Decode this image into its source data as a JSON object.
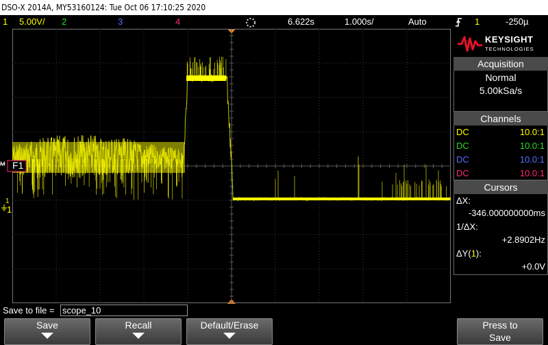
{
  "title_bar": {
    "text": "DSO-X 2014A, MY53160124: Tue Oct 06 17:10:25 2020"
  },
  "status": {
    "ch1_num": "1",
    "ch1_scale": "5.00V/",
    "ch2_num": "2",
    "ch3_num": "3",
    "ch4_num": "4",
    "time_delay": "6.622s",
    "time_scale": "1.000s/",
    "trigger_mode": "Auto",
    "trigger_icon": "trigger-rising-edge-icon",
    "trigger_source": "1",
    "trigger_level": "-250µ"
  },
  "markers": {
    "ground_label": "F1",
    "trigger_level_label": "1",
    "ch1_label": "1",
    "ground_marker_text": "M"
  },
  "logo": {
    "name": "KEYSIGHT",
    "sub": "TECHNOLOGIES"
  },
  "acquisition": {
    "header": "Acquisition",
    "mode": "Normal",
    "rate": "5.00kSa/s"
  },
  "channels": {
    "header": "Channels",
    "rows": [
      {
        "coupling": "DC",
        "probe": "10.0:1",
        "color": "#ffff00"
      },
      {
        "coupling": "DC",
        "probe": "10.0:1",
        "color": "#28e028"
      },
      {
        "coupling": "DC",
        "probe": "10.0:1",
        "color": "#5a6cff"
      },
      {
        "coupling": "DC",
        "probe": "10.0:1",
        "color": "#ff2a72"
      }
    ]
  },
  "cursors": {
    "header": "Cursors",
    "dx_label": "ΔX:",
    "dx_value": "-346.000000000ms",
    "inv_dx_label": "1/ΔX:",
    "inv_dx_value": "+2.8902Hz",
    "dy_label_prefix": "ΔY(",
    "dy_channel": "1",
    "dy_label_suffix": "):",
    "dy_value": "+0.0V"
  },
  "file": {
    "label": "Save to file =",
    "value": "scope_10"
  },
  "softkeys": {
    "save": "Save",
    "recall": "Recall",
    "default_erase": "Default/Erase",
    "press_to": "Press to",
    "press_save": "Save"
  },
  "colors": {
    "ch1": "#ffff00",
    "ch2": "#28e028",
    "ch3": "#5a6cff",
    "ch4": "#ff2a72",
    "panel_header": "#4a4a4a",
    "trigger_marker": "#ff8c1a"
  }
}
